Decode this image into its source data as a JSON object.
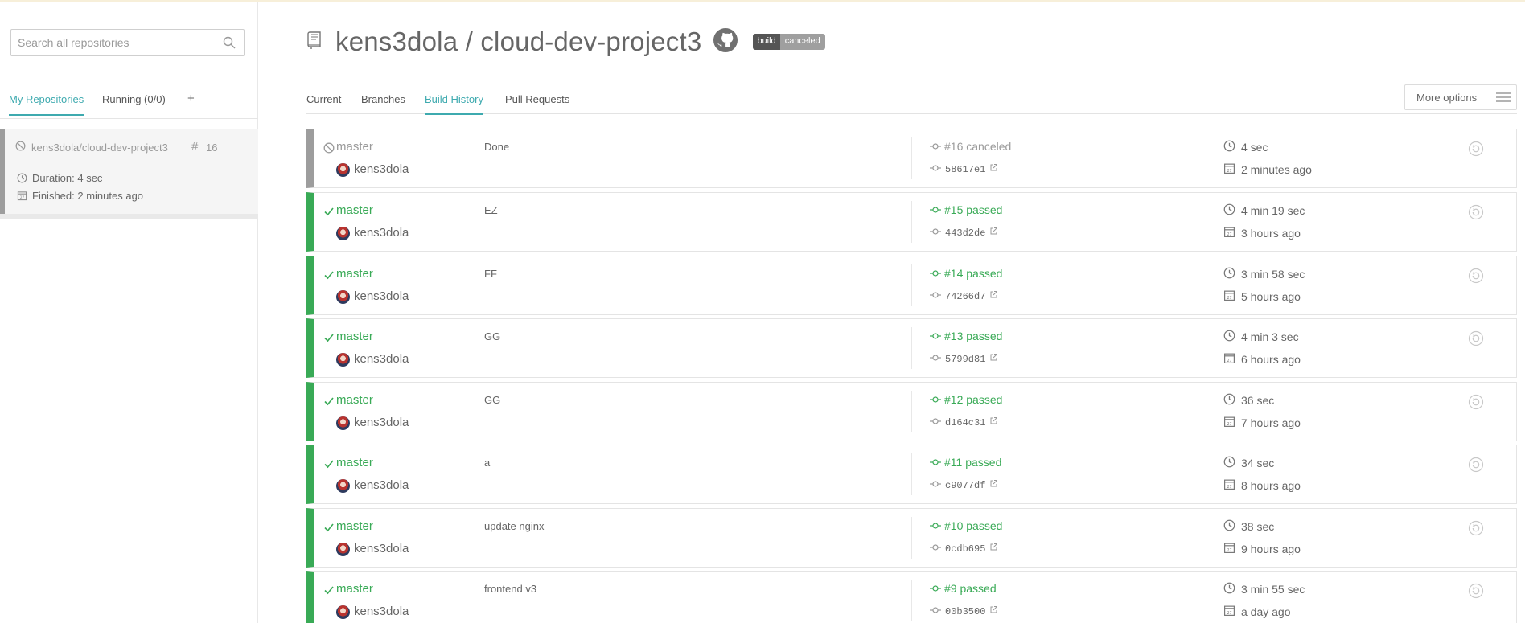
{
  "sidebar": {
    "search_placeholder": "Search all repositories",
    "tabs": {
      "my_repos": "My Repositories",
      "running": "Running (0/0)",
      "add": "+"
    },
    "repo": {
      "name": "kens3dola/cloud-dev-project3",
      "hash": "#",
      "build_number": "16",
      "duration": "Duration: 4 sec",
      "finished": "Finished: 2 minutes ago",
      "status": "canceled"
    }
  },
  "header": {
    "title": "kens3dola / cloud-dev-project3",
    "badge_left": "build",
    "badge_right": "canceled"
  },
  "tabs": {
    "current": "Current",
    "branches": "Branches",
    "build_history": "Build History",
    "pull_requests": "Pull Requests",
    "more_options": "More options"
  },
  "colors": {
    "passed": "#39aa56",
    "canceled": "#9d9d9d",
    "accent": "#3eaaaf"
  },
  "builds": [
    {
      "status": "canceled",
      "branch": "master",
      "author": "kens3dola",
      "message": "Done",
      "build": "#16 canceled",
      "commit": "58617e1",
      "duration": "4 sec",
      "finished": "2 minutes ago"
    },
    {
      "status": "passed",
      "branch": "master",
      "author": "kens3dola",
      "message": "EZ",
      "build": "#15 passed",
      "commit": "443d2de",
      "duration": "4 min 19 sec",
      "finished": "3 hours ago"
    },
    {
      "status": "passed",
      "branch": "master",
      "author": "kens3dola",
      "message": "FF",
      "build": "#14 passed",
      "commit": "74266d7",
      "duration": "3 min 58 sec",
      "finished": "5 hours ago"
    },
    {
      "status": "passed",
      "branch": "master",
      "author": "kens3dola",
      "message": "GG",
      "build": "#13 passed",
      "commit": "5799d81",
      "duration": "4 min 3 sec",
      "finished": "6 hours ago"
    },
    {
      "status": "passed",
      "branch": "master",
      "author": "kens3dola",
      "message": "GG",
      "build": "#12 passed",
      "commit": "d164c31",
      "duration": "36 sec",
      "finished": "7 hours ago"
    },
    {
      "status": "passed",
      "branch": "master",
      "author": "kens3dola",
      "message": "a",
      "build": "#11 passed",
      "commit": "c9077df",
      "duration": "34 sec",
      "finished": "8 hours ago"
    },
    {
      "status": "passed",
      "branch": "master",
      "author": "kens3dola",
      "message": "update nginx",
      "build": "#10 passed",
      "commit": "0cdb695",
      "duration": "38 sec",
      "finished": "9 hours ago"
    },
    {
      "status": "passed",
      "branch": "master",
      "author": "kens3dola",
      "message": "frontend v3",
      "build": "#9 passed",
      "commit": "00b3500",
      "duration": "3 min 55 sec",
      "finished": "a day ago"
    }
  ]
}
